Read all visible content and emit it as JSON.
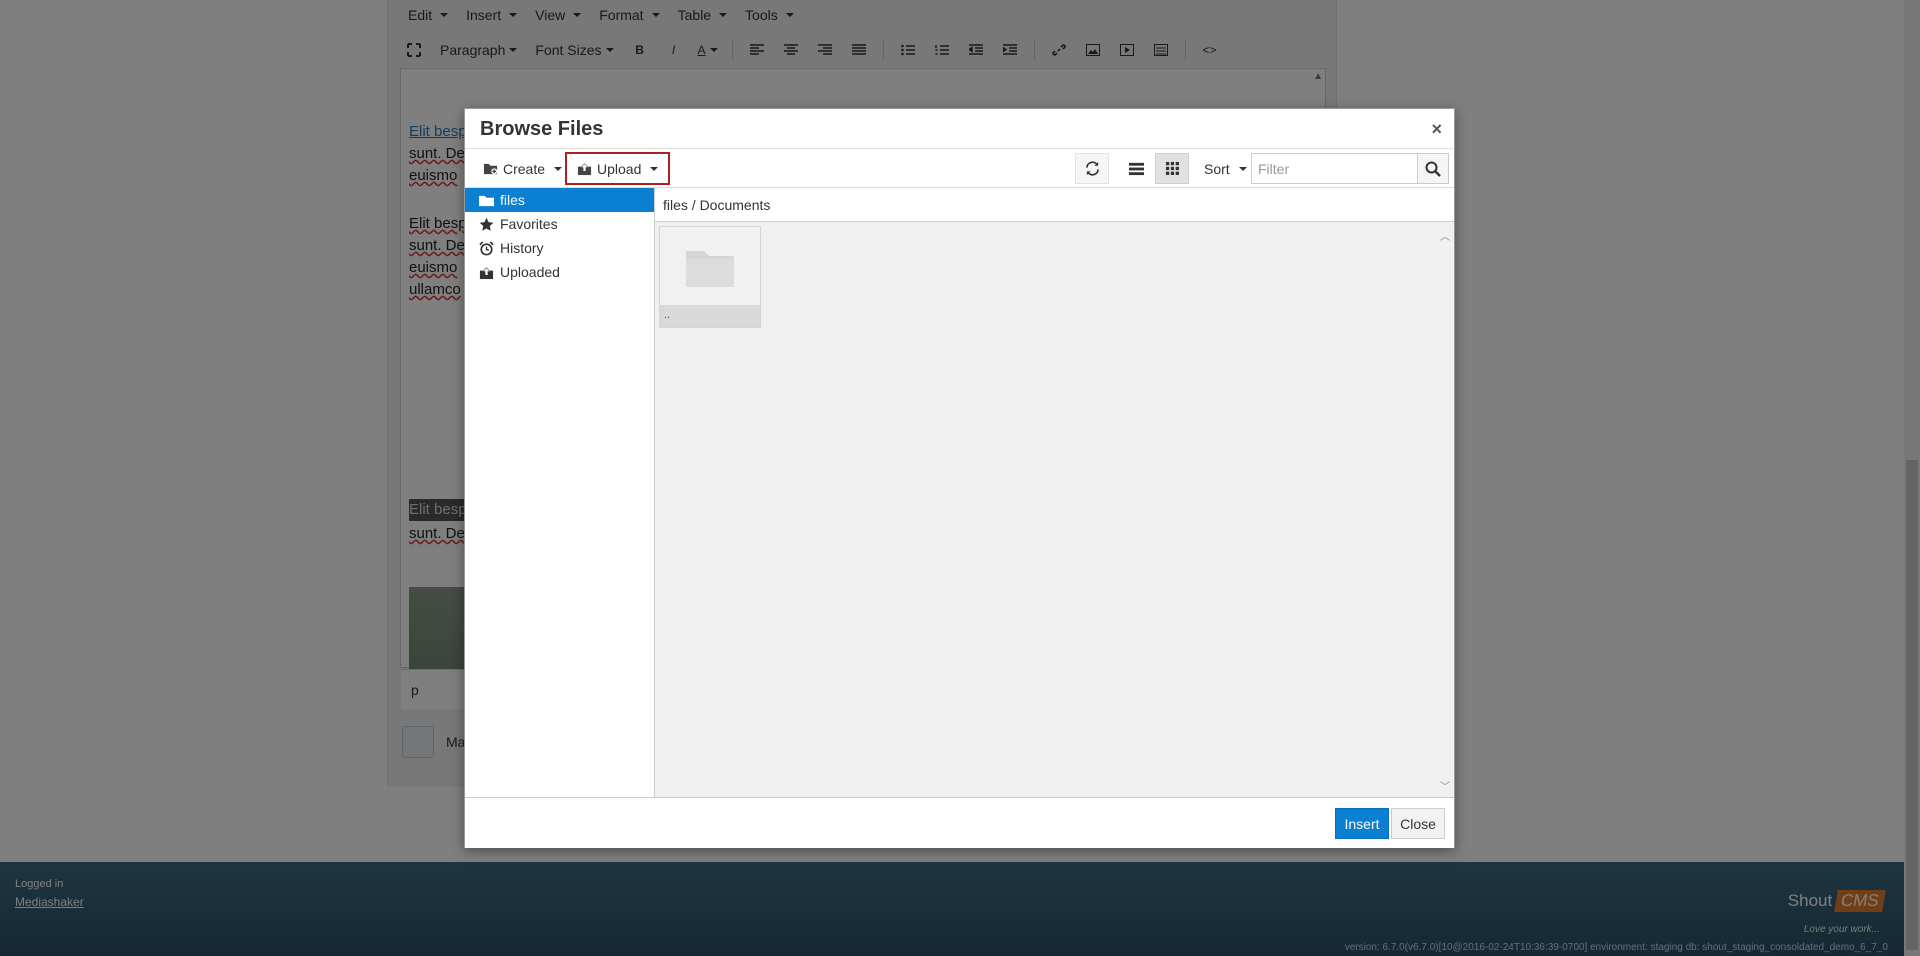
{
  "editor": {
    "menu": [
      "Edit",
      "Insert",
      "View",
      "Format",
      "Table",
      "Tools"
    ],
    "toolbar": {
      "paragraph": "Paragraph",
      "font_sizes": "Font Sizes",
      "bold": "B",
      "italic": "I",
      "font_color": "A",
      "code": "<>"
    },
    "lines": [
      "Elit besp",
      "sunt. De",
      "euismo",
      "Elit besp",
      "sunt. De",
      "euismo",
      "ullamco",
      "Elit besp",
      "sunt. De"
    ],
    "status_path": "p",
    "below_label": "Ma"
  },
  "modal": {
    "title": "Browse Files",
    "close_glyph": "×",
    "toolbar": {
      "create_label": "Create",
      "upload_label": "Upload",
      "sort_label": "Sort",
      "filter_placeholder": "Filter"
    },
    "sidebar": {
      "items": [
        {
          "label": "files",
          "icon": "folder-icon",
          "active": true
        },
        {
          "label": "Favorites",
          "icon": "star-icon",
          "active": false
        },
        {
          "label": "History",
          "icon": "alarm-clock-icon",
          "active": false
        },
        {
          "label": "Uploaded",
          "icon": "upload-box-icon",
          "active": false
        }
      ]
    },
    "breadcrumb": "files / Documents",
    "files": [
      {
        "name": "..",
        "icon": "folder-icon"
      }
    ],
    "footer": {
      "insert_label": "Insert",
      "close_label": "Close"
    }
  },
  "footer": {
    "logged_in_label": "Logged in",
    "username": "Mediashaker",
    "brand_part1": "Shout",
    "brand_part2": "CMS",
    "tagline": "Love your work...",
    "version": "version: 6.7.0(v6.7.0)[10@2016-02-24T10:36:39-0700] environment: staging db: shout_staging_consoldated_demo_6_7_0"
  },
  "colors": {
    "accent": "#0b7fd1",
    "highlight_border": "#b21d1d",
    "brand_orange": "#e57d2b"
  }
}
